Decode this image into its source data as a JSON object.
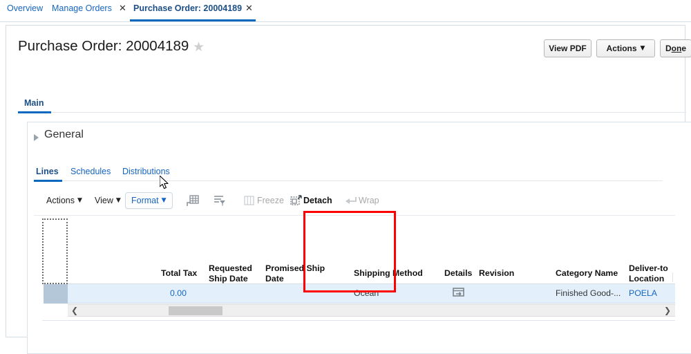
{
  "browser_tabs": [
    {
      "label": "Overview",
      "active": false,
      "closable": false
    },
    {
      "label": "Manage Orders",
      "active": false,
      "closable": true,
      "close_glyph": "✕"
    },
    {
      "label": "Purchase Order: 20004189",
      "active": true,
      "closable": true,
      "close_glyph": "✕"
    }
  ],
  "header": {
    "title": "Purchase Order: 20004189",
    "star_icon": "star-icon",
    "star_glyph": "★",
    "buttons": {
      "view_pdf": "View PDF",
      "actions": "Actions",
      "actions_caret": "▼",
      "done_prefix": "D",
      "done_underlined": "on",
      "done_suffix": "e"
    }
  },
  "main_tab": {
    "label": "Main"
  },
  "general_section": {
    "label": "General",
    "expanded": false
  },
  "sub_tabs": [
    {
      "label": "Lines",
      "active": true
    },
    {
      "label": "Schedules",
      "active": false
    },
    {
      "label": "Distributions",
      "active": false
    }
  ],
  "toolbar": {
    "actions": "Actions",
    "view": "View",
    "format": "Format",
    "caret": "▼",
    "freeze": "Freeze",
    "detach": "Detach",
    "wrap": "Wrap",
    "icons": [
      "insert-row-icon",
      "filter-icon",
      "columns-icon",
      "freeze-icon",
      "detach-icon",
      "wrap-icon"
    ],
    "states": {
      "freeze": "disabled",
      "detach": "enabled",
      "wrap": "disabled",
      "format": "focused"
    }
  },
  "table": {
    "columns": [
      {
        "header": "Total Tax",
        "align": "right"
      },
      {
        "header": "Requested\nShip Date",
        "align": "left"
      },
      {
        "header": "Promised Ship\nDate",
        "align": "left"
      },
      {
        "header": "Shipping Method",
        "align": "left"
      },
      {
        "header": "Details",
        "align": "left"
      },
      {
        "header": "Revision",
        "align": "left"
      },
      {
        "header": "Category Name",
        "align": "left"
      },
      {
        "header": "Deliver-to\nLocation",
        "align": "left"
      }
    ],
    "rows": [
      {
        "selected": true,
        "total_tax": "0.00",
        "requested_ship_date": "",
        "promised_ship_date": "",
        "shipping_method": "Ocean",
        "details_icon": "details-icon",
        "revision": "",
        "category_name": "Finished Good-...",
        "deliver_to_location": "POELA"
      }
    ],
    "scrollbar": {
      "left_arrow": "❮",
      "right_arrow": "❯"
    }
  },
  "annotation": {
    "type": "highlight-rectangle",
    "target": "Shipping Method",
    "color": "#ff0000"
  },
  "colors": {
    "accent_blue": "#0a68c1",
    "link_blue": "#1565c0",
    "row_selected_bg": "#e3f0fb",
    "row_header_selected": "#b4c7d9",
    "annotation_red": "#ff0000"
  }
}
